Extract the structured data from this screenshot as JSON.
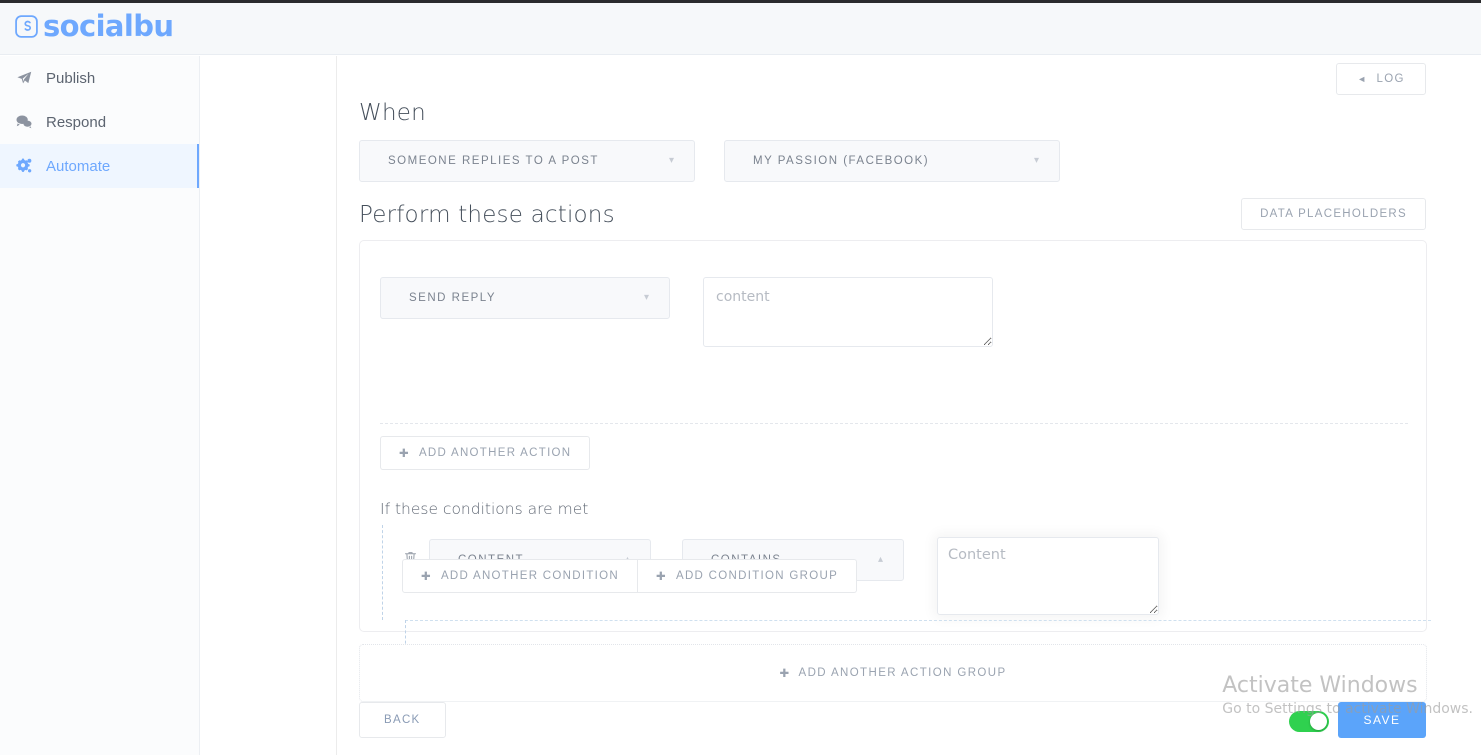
{
  "app": {
    "brand": "socialbu",
    "logo_icon": "socialbu-s-mark",
    "accent_color": "#6ea8fe",
    "save_color": "#5ba4fa",
    "toggle_on_color": "#2fd14f"
  },
  "sidebar": {
    "items": [
      {
        "label": "Publish",
        "icon": "paper-plane-icon",
        "active": false
      },
      {
        "label": "Respond",
        "icon": "comments-icon",
        "active": false
      },
      {
        "label": "Automate",
        "icon": "cogs-icon",
        "active": true
      }
    ]
  },
  "toolbar": {
    "log_label": "LOG",
    "log_icon": "caret-left-icon",
    "data_placeholders_label": "DATA PLACEHOLDERS"
  },
  "when": {
    "title": "When",
    "trigger_select": {
      "value": "SOMEONE REPLIES TO A POST",
      "chevron": "chevron-down-icon"
    },
    "account_select": {
      "value": "MY PASSION (FACEBOOK)",
      "chevron": "chevron-down-icon"
    }
  },
  "actions": {
    "title": "Perform these actions",
    "action_select": {
      "value": "SEND REPLY",
      "chevron": "chevron-down-icon"
    },
    "content_textarea": {
      "value": "",
      "placeholder": "content"
    },
    "add_another_action_label": "ADD ANOTHER ACTION",
    "add_icon": "plus-icon"
  },
  "conditions": {
    "label": "If these conditions are met",
    "delete_icon": "trash-icon",
    "rows": [
      {
        "field_select": {
          "value": "CONTENT",
          "chevron": "chevron-up-icon"
        },
        "operator_select": {
          "value": "CONTAINS",
          "chevron": "chevron-up-icon"
        },
        "value_textarea": {
          "value": "",
          "placeholder": "Content",
          "focused": true
        }
      }
    ],
    "add_another_condition_label": "ADD ANOTHER CONDITION",
    "add_condition_group_label": "ADD CONDITION GROUP"
  },
  "footer": {
    "add_another_action_group_label": "ADD ANOTHER ACTION GROUP",
    "back_label": "BACK",
    "save_label": "SAVE",
    "enabled_toggle": true
  },
  "watermark": {
    "title": "Activate Windows",
    "subtitle": "Go to Settings to activate Windows."
  }
}
